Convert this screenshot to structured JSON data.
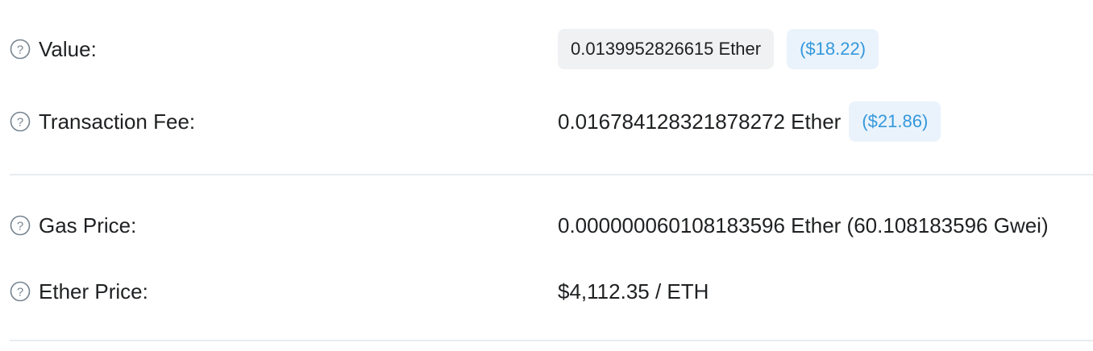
{
  "rows": {
    "value": {
      "label": "Value:",
      "amount": "0.0139952826615 Ether",
      "usd": "($18.22)"
    },
    "fee": {
      "label": "Transaction Fee:",
      "amount": "0.016784128321878272 Ether",
      "usd": "($21.86)"
    },
    "gas_price": {
      "label": "Gas Price:",
      "amount": "0.000000060108183596 Ether (60.108183596 Gwei)"
    },
    "ether_price": {
      "label": "Ether Price:",
      "amount": "$4,112.35 / ETH"
    }
  },
  "icons": {
    "help": "question-circle-icon"
  },
  "colors": {
    "accent": "#3498db",
    "pill_gray_bg": "#eff1f3",
    "pill_blue_bg": "#eaf3fc",
    "divider": "#e9ecef"
  }
}
